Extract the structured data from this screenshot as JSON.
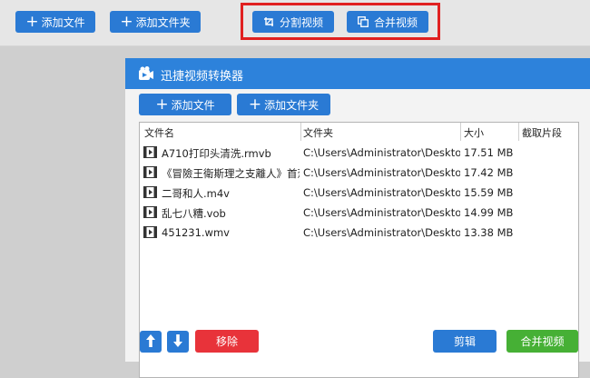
{
  "toolbar": {
    "add_file_label": "添加文件",
    "add_folder_label": "添加文件夹",
    "split_video_label": "分割视频",
    "merge_video_label": "合并视频"
  },
  "window": {
    "title": "迅捷视频转换器",
    "add_file_label": "添加文件",
    "add_folder_label": "添加文件夹",
    "columns": [
      "文件名",
      "文件夹",
      "大小",
      "截取片段"
    ],
    "files": [
      {
        "name": "A710打印头清洗.rmvb",
        "folder": "C:\\Users\\Administrator\\Desktop",
        "size": "17.51 MB"
      },
      {
        "name": "《冒險王衛斯理之支離人》首葱",
        "folder": "C:\\Users\\Administrator\\Desktop",
        "size": "17.42 MB"
      },
      {
        "name": "二哥和人.m4v",
        "folder": "C:\\Users\\Administrator\\Desktop",
        "size": "15.59 MB"
      },
      {
        "name": "乱七八糟.vob",
        "folder": "C:\\Users\\Administrator\\Desktop",
        "size": "14.99 MB"
      },
      {
        "name": "451231.wmv",
        "folder": "C:\\Users\\Administrator\\Desktop",
        "size": "13.38 MB"
      }
    ],
    "remove_label": "移除",
    "edit_label": "剪辑",
    "merge_label": "合并视频"
  },
  "colors": {
    "accent_blue": "#2a7ad4",
    "title_blue": "#2d82db",
    "merge_green": "#46b035",
    "remove_red": "#e8333a",
    "highlight_red": "#e02020"
  },
  "icons": [
    "plus-icon",
    "split-icon",
    "merge-icon",
    "app-logo-icon",
    "video-file-icon",
    "arrow-up-icon",
    "arrow-down-icon"
  ]
}
